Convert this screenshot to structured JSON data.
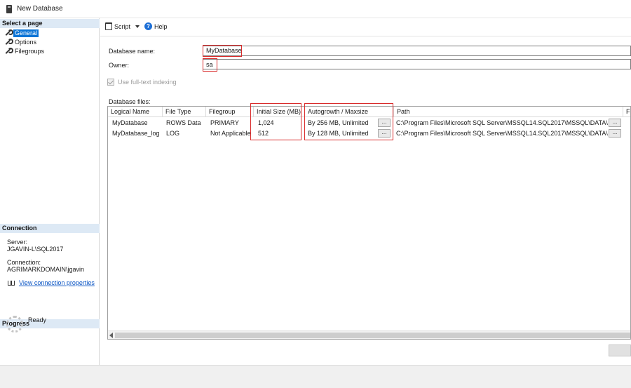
{
  "window": {
    "title": "New Database"
  },
  "select_page": {
    "header": "Select a page",
    "items": [
      {
        "label": "General",
        "selected": true
      },
      {
        "label": "Options",
        "selected": false
      },
      {
        "label": "Filegroups",
        "selected": false
      }
    ]
  },
  "connection": {
    "header": "Connection",
    "server_label": "Server:",
    "server_value": "JGAVIN-L\\SQL2017",
    "connection_label": "Connection:",
    "connection_value": "AGRIMARKDOMAIN\\jgavin",
    "link": "View connection properties"
  },
  "progress": {
    "header": "Progress",
    "status": "Ready"
  },
  "toolbar": {
    "script_label": "Script",
    "help_label": "Help"
  },
  "general": {
    "db_name_label": "Database name:",
    "db_name_value": "MyDatabase",
    "owner_label": "Owner:",
    "owner_value": "sa",
    "fulltext_label": "Use full-text indexing",
    "db_files_label": "Database files:"
  },
  "files_table": {
    "columns": [
      "Logical Name",
      "File Type",
      "Filegroup",
      "Initial Size (MB)",
      "Autogrowth / Maxsize",
      "Path",
      "Fi"
    ],
    "rows": [
      {
        "logical_name": "MyDatabase",
        "file_type": "ROWS Data",
        "filegroup": "PRIMARY",
        "initial_size": "1,024",
        "autogrowth": "By 256 MB, Unlimited",
        "path": "C:\\Program Files\\Microsoft SQL Server\\MSSQL14.SQL2017\\MSSQL\\DATA\\"
      },
      {
        "logical_name": "MyDatabase_log",
        "file_type": "LOG",
        "filegroup": "Not Applicable",
        "initial_size": "512",
        "autogrowth": "By 128 MB, Unlimited",
        "path": "C:\\Program Files\\Microsoft SQL Server\\MSSQL14.SQL2017\\MSSQL\\DATA\\"
      }
    ],
    "ellipsis": "..."
  },
  "colors": {
    "selection": "#0b74d6",
    "section_header": "#dde9f5",
    "highlight_box": "#d92b2b",
    "link": "#0b55c4"
  }
}
